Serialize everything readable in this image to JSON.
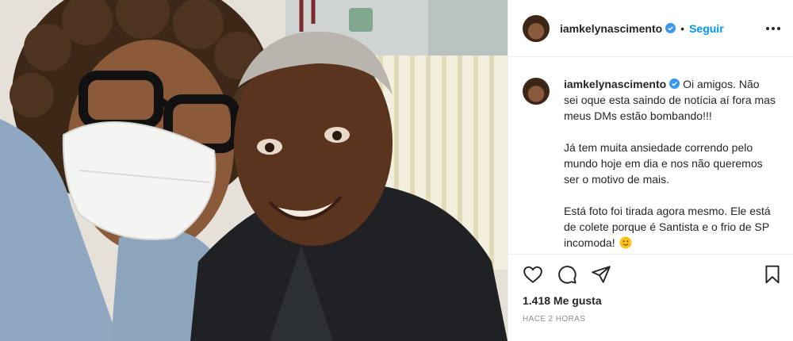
{
  "post": {
    "username": "iamkelynascimento",
    "separator": "•",
    "follow_label": "Seguir",
    "caption_paragraphs": [
      "Oi amigos. Não sei oque esta saindo de notícia aí fora mas meus DMs estão bombando!!!",
      "Já tem muita ansiedade correndo pelo mundo hoje em dia e nos não queremos ser o motivo de mais.",
      "Está foto foi tirada agora mesmo. Ele está de colete porque é Santista e o frio de SP incomoda!"
    ],
    "caption_emoji": "smiling-face-emoji",
    "likes_text": "1.418 Me gusta",
    "timestamp": "HACE 2 HORAS"
  },
  "icons": {
    "verified": "verified-badge-icon",
    "more": "more-options-icon",
    "like": "heart-icon",
    "comment": "comment-bubble-icon",
    "share": "paper-plane-icon",
    "save": "bookmark-icon"
  },
  "colors": {
    "link_blue": "#0095f6",
    "text": "#262626",
    "muted": "#8e8e8e",
    "border": "#efefef"
  }
}
